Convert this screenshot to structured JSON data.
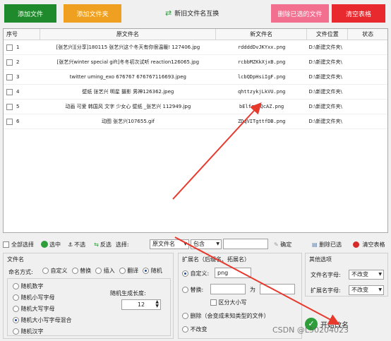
{
  "toolbar": {
    "add_files": "添加文件",
    "add_folder": "添加文件夹",
    "swap_names": "新旧文件名互换",
    "delete_selected": "删除已选的文件",
    "clear_table": "清空表格"
  },
  "grid": {
    "columns": [
      "序号",
      "原文件名",
      "新文件名",
      "文件位置",
      "状态"
    ],
    "rows": [
      {
        "no": "1",
        "orig": "[张艺兴][分享]180115 张艺兴这个冬天有你很温暖! 127406.jpg",
        "new": "rddddDvJKYxx.png",
        "loc": "D:\\新建文件夹\\",
        "status": ""
      },
      {
        "no": "2",
        "orig": "[张艺兴winter special gift]冬冬初次试听 reaction126065.jpg",
        "new": "rcbbMZKkXjxB.png",
        "loc": "D:\\新建文件夹\\",
        "status": ""
      },
      {
        "no": "3",
        "orig": "twitter uming_exo 676767 676767116693.jpeg",
        "new": "lcbQDpHsiIgF.png",
        "loc": "D:\\新建文件夹\\",
        "status": ""
      },
      {
        "no": "4",
        "orig": "壁纸 张艺兴 明星 摄影 男神126362.jpeg",
        "new": "qhttzykjLkVU.png",
        "loc": "D:\\新建文件夹\\",
        "status": ""
      },
      {
        "no": "5",
        "orig": "动画 可爱 韩国风 文字 少女心 壁纸 _张艺兴 112949.jpg",
        "new": "bElfrpBQcAZ.png",
        "loc": "D:\\新建文件夹\\",
        "status": ""
      },
      {
        "no": "6",
        "orig": "动图 张艺兴107655.gif",
        "new": "ZDqVITgttfDB.png",
        "loc": "D:\\新建文件夹\\",
        "status": ""
      }
    ]
  },
  "selbar": {
    "select_all": "全部选择",
    "select": "选中",
    "unselect": "不选",
    "invert": "反选",
    "choose": "选择:",
    "field": "原文件名",
    "mode": "包含",
    "confirm": "确定",
    "delete_selected": "删除已选",
    "clear_table": "清空表格"
  },
  "filename_panel": {
    "title": "文件名",
    "naming_label": "命名方式:",
    "modes": [
      "自定义",
      "替换",
      "插入",
      "翻译",
      "随机"
    ],
    "random_options": [
      "随机数字",
      "随机小写字母",
      "随机大写字母",
      "随机大小写字母混合",
      "随机汉字"
    ],
    "length_label": "随机生成长度:",
    "length_value": "12"
  },
  "ext_panel": {
    "title": "扩展名（后缀名、拓展名）",
    "custom_label": "自定义:",
    "custom_value": "png",
    "replace_label": "替换:",
    "as_label": "为",
    "case_label": "区分大小写",
    "delete_label": "删除（会变成未知类型的文件）",
    "keep_label": "不改变"
  },
  "other_panel": {
    "title": "其他选项",
    "fname_case_label": "文件名字母:",
    "fname_case_value": "不改变",
    "ext_case_label": "扩展名字母:",
    "ext_case_value": "不改变"
  },
  "start_button": "开始改名",
  "watermark": "CSDN @L50204023",
  "colors": {
    "green": "#1f8a2b",
    "orange": "#f0a020",
    "pink": "#f36f90",
    "red": "#e8292d",
    "arrow": "#e8392d"
  }
}
